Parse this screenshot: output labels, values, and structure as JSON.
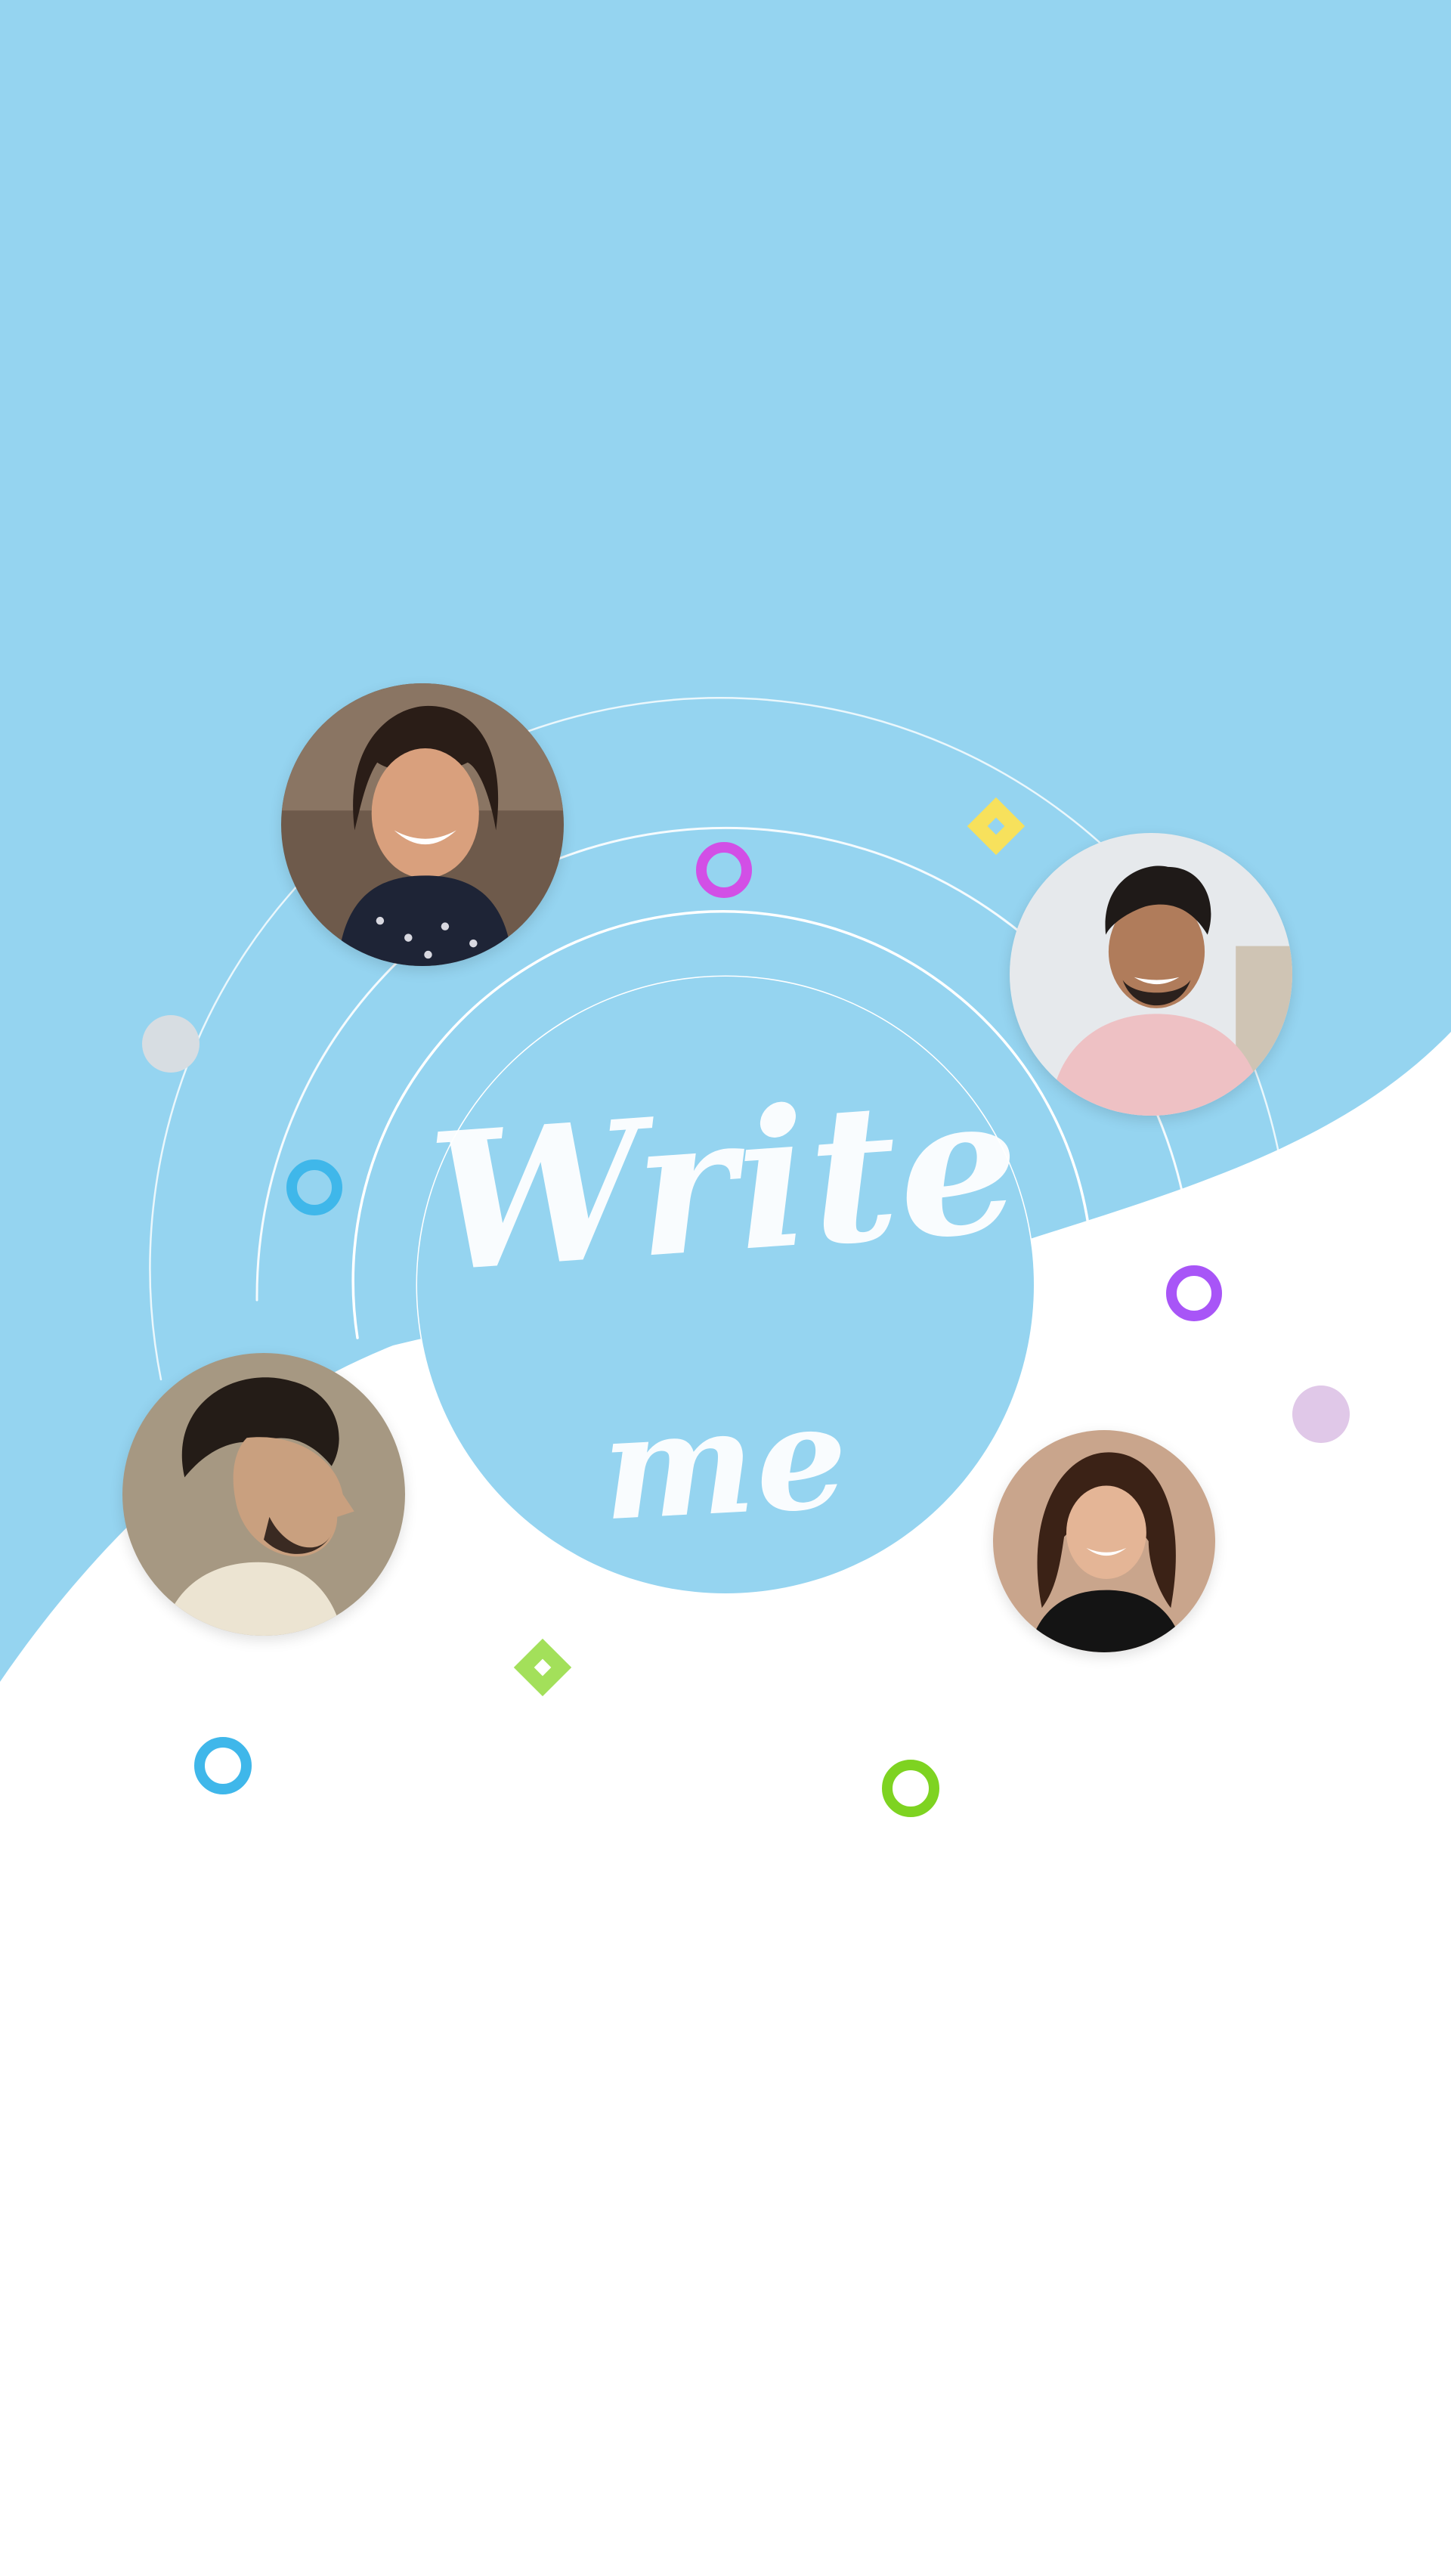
{
  "headline": {
    "line1": "Write",
    "line2": "me"
  },
  "colors": {
    "sky": "#95d4f0",
    "white": "#ffffff",
    "ring": "#ffffff",
    "magenta": "#d24fe6",
    "purple": "#a855f7",
    "blue": "#3fb7ea",
    "green": "#7ed321",
    "lime": "#a3e05a",
    "yellow": "#f7e15c",
    "grey": "#d7dde2",
    "lilac": "#e0c8e8"
  },
  "avatars": [
    {
      "name": "smiling-woman-avatar"
    },
    {
      "name": "smiling-man-avatar"
    },
    {
      "name": "profile-man-avatar"
    },
    {
      "name": "smiling-woman-2-avatar"
    }
  ],
  "decorations": [
    "magenta-ring-icon",
    "yellow-diamond-icon",
    "grey-dot-icon",
    "blue-ring-icon",
    "purple-ring-icon",
    "lilac-dot-icon",
    "green-diamond-icon",
    "blue-ring-bottom-icon",
    "green-ring-icon"
  ]
}
